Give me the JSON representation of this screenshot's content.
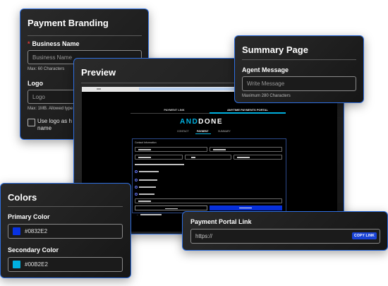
{
  "branding": {
    "title": "Payment Branding",
    "business_label": "Business Name",
    "business_placeholder": "Business Name",
    "business_hint": "Max: 60 Characters",
    "logo_label": "Logo",
    "logo_placeholder": "Logo",
    "logo_hint": "Max: 1MB. Allowed type",
    "checkbox_label_line1": "Use logo as h",
    "checkbox_label_line2": "name"
  },
  "summary": {
    "title": "Summary Page",
    "agent_label": "Agent Message",
    "agent_placeholder": "Write Message",
    "agent_hint": "Maximum 280 Characters"
  },
  "preview": {
    "title": "Preview",
    "tabs": [
      "PAYMENT LINK",
      "ANYTIME PAYMENTS PORTAL"
    ],
    "logo_text_a": "AND",
    "logo_text_b": "DONE",
    "steps": [
      "CONTACT",
      "PAYMENT",
      "SUMMARY"
    ],
    "section_label": "Contact Information"
  },
  "colors": {
    "title": "Colors",
    "primary_label": "Primary Color",
    "primary_value": "#0832E2",
    "secondary_label": "Secondary Color",
    "secondary_value": "#00B2E2"
  },
  "portal": {
    "title": "Payment Portal Link",
    "url_value": "https://",
    "copy_label": "COPY LINK"
  }
}
